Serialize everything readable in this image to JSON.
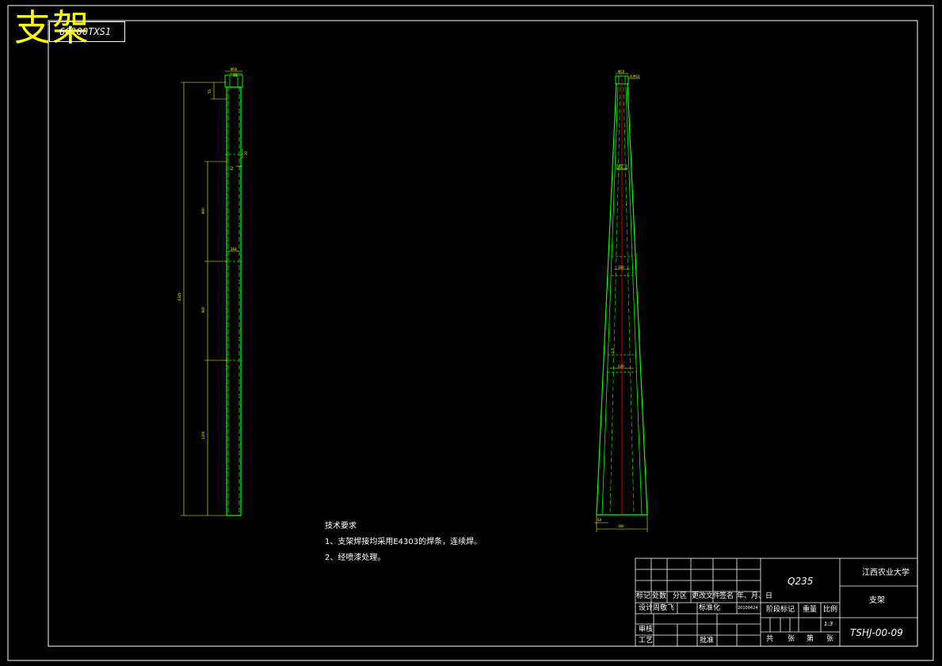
{
  "header": {
    "title": "支架",
    "drawing_number_rotated": "60°00TXS1"
  },
  "notes": {
    "heading": "技术要求",
    "items": [
      "1、支架焊接均采用E4303的焊条，连续焊。",
      "2、经喷漆处理。"
    ]
  },
  "title_block": {
    "material": "Q235",
    "school": "江西农业大学",
    "part_name": "支架",
    "drawing_code": "TSHJ-00-09",
    "labels": {
      "mark": "标记",
      "count": "处数",
      "zone": "分区",
      "change_doc": "更改文件",
      "signature": "签名",
      "date": "年、月、日",
      "design": "设计",
      "designer": "周敬飞",
      "standardize": "标准化",
      "review": "审核",
      "process": "工艺",
      "approve": "批准",
      "stage_mark": "阶段标记",
      "weight": "重量",
      "scale": "比例",
      "scale_value": "1:3",
      "total": "共",
      "sheets": "张",
      "sheet_no": "第",
      "sheet": "张",
      "sign_date": "20100424"
    }
  },
  "colors": {
    "background": "#000000",
    "frame": "#ffffff",
    "part_outline": "#00ff00",
    "dimension": "#ffff00",
    "centerline": "#ff0000",
    "title_text": "#ffff00"
  }
}
